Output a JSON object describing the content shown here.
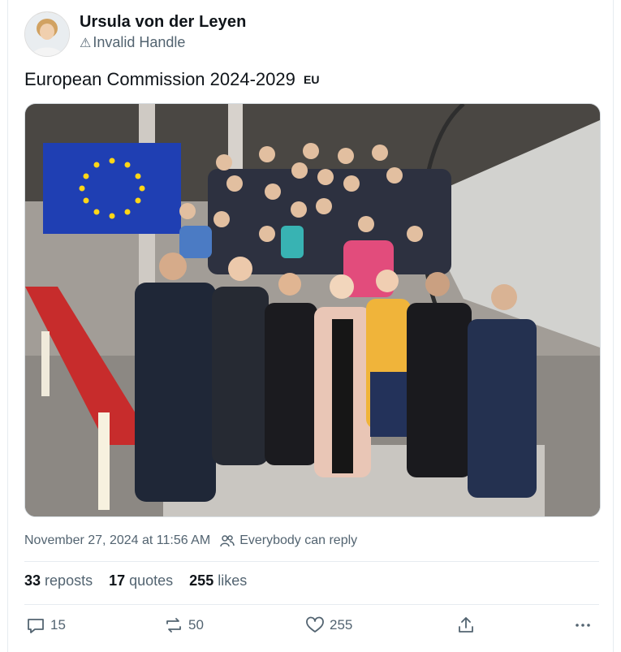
{
  "author": {
    "name": "Ursula von der Leyen",
    "handle": "Invalid Handle"
  },
  "post": {
    "text": "European Commission 2024-2029",
    "flag_text": "EU"
  },
  "meta": {
    "timestamp": "November 27, 2024 at 11:56 AM",
    "reply_setting": "Everybody can reply"
  },
  "stats": {
    "reposts_count": "33",
    "reposts_label": "reposts",
    "quotes_count": "17",
    "quotes_label": "quotes",
    "likes_count": "255",
    "likes_label": "likes"
  },
  "actions": {
    "reply_count": "15",
    "repost_count": "50",
    "like_count": "255"
  },
  "colors": {
    "secondary_text": "#536471",
    "eu_flag_blue": "#1f3fb3",
    "eu_star_yellow": "#ffd617"
  },
  "icons": {
    "warn": "warning-icon",
    "reply_setting": "people-icon",
    "reply": "reply-icon",
    "repost": "repost-icon",
    "like": "heart-icon",
    "share": "share-icon",
    "more": "more-icon"
  }
}
